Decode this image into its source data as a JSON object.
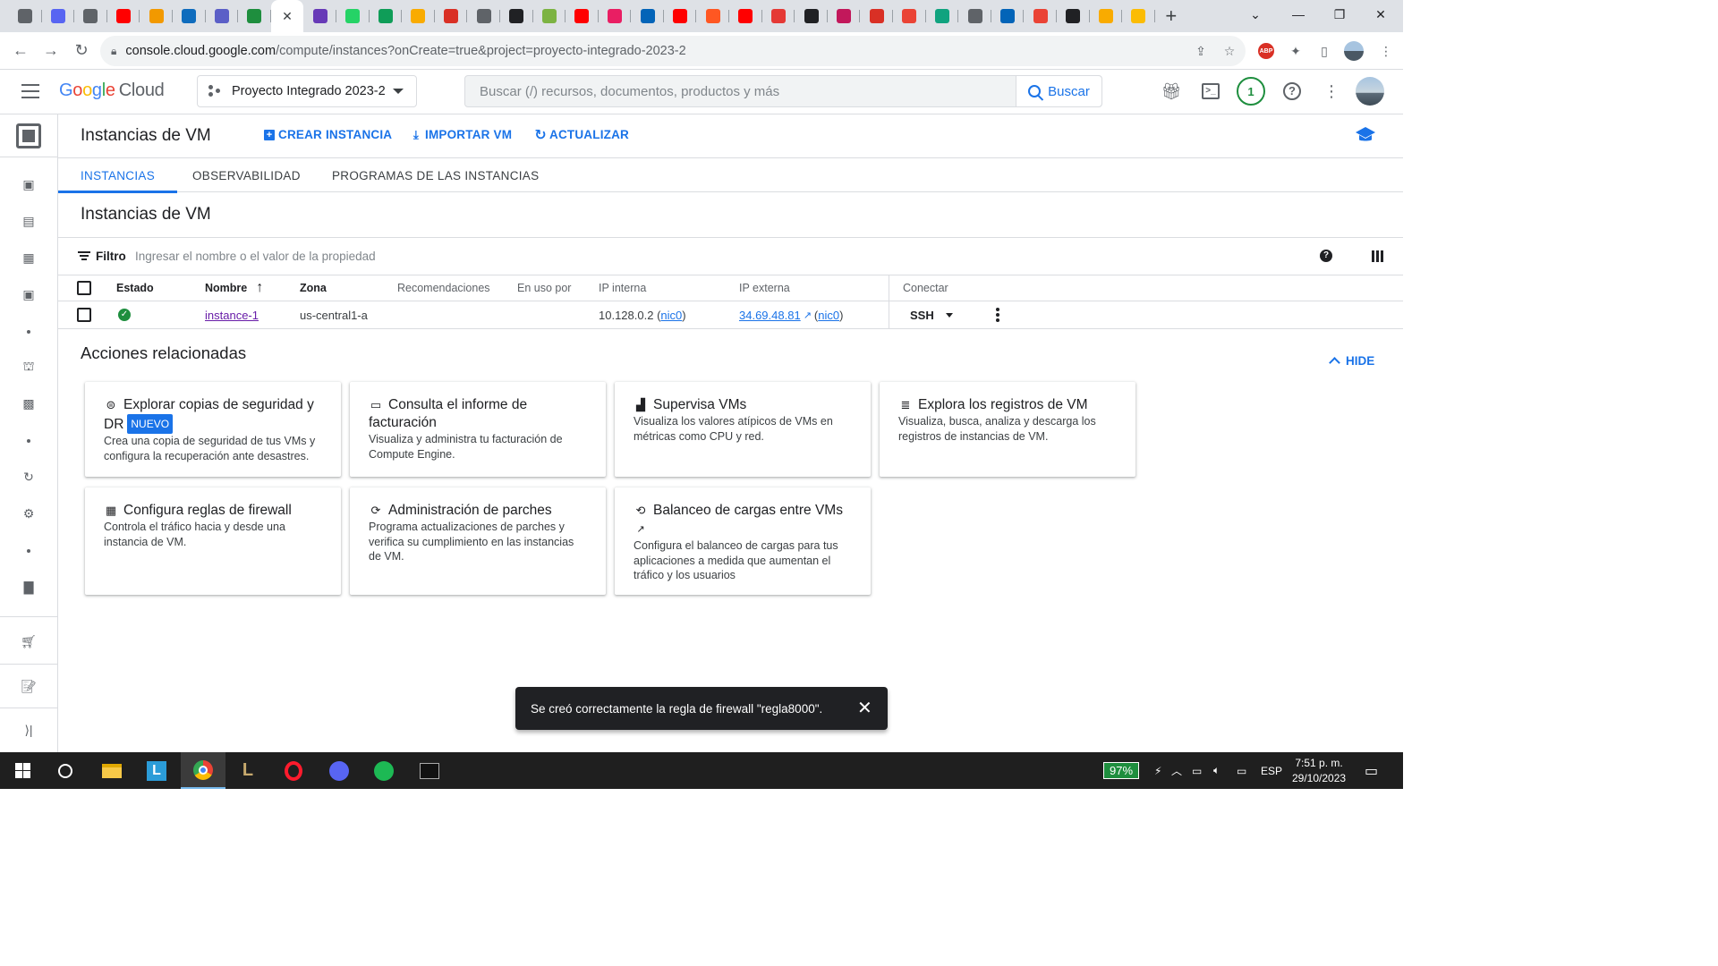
{
  "browser": {
    "tabs": [
      {
        "icon": "chrome-icon",
        "color": "#5f6368"
      },
      {
        "icon": "discord-icon",
        "color": "#5865f2"
      },
      {
        "icon": "chrome-icon",
        "color": "#5f6368"
      },
      {
        "icon": "youtube-icon",
        "color": "#ff0000"
      },
      {
        "icon": "app-icon",
        "color": "#f29900"
      },
      {
        "icon": "outlook-icon",
        "color": "#0f6cbd"
      },
      {
        "icon": "teams-icon",
        "color": "#5b5fc7"
      },
      {
        "icon": "drive-icon",
        "color": "#1e8e3e"
      },
      {
        "icon": "close-icon",
        "color": "#3c4043",
        "active": true
      },
      {
        "icon": "forms-icon",
        "color": "#673ab7"
      },
      {
        "icon": "whatsapp-icon",
        "color": "#25d366"
      },
      {
        "icon": "sheets-icon",
        "color": "#0f9d58"
      },
      {
        "icon": "app-icon",
        "color": "#f9ab00"
      },
      {
        "icon": "app-icon",
        "color": "#d93025"
      },
      {
        "icon": "cisco-icon",
        "color": "#5f6368"
      },
      {
        "icon": "h-icon",
        "color": "#202124"
      },
      {
        "icon": "app-icon",
        "color": "#7cb342"
      },
      {
        "icon": "youtube-icon",
        "color": "#ff0000"
      },
      {
        "icon": "ef-icon",
        "color": "#e91e63"
      },
      {
        "icon": "onedrive-icon",
        "color": "#0364b8"
      },
      {
        "icon": "youtube-icon",
        "color": "#ff0000"
      },
      {
        "icon": "app-icon",
        "color": "#ff5722"
      },
      {
        "icon": "youtube-icon",
        "color": "#ff0000"
      },
      {
        "icon": "app-icon",
        "color": "#e53935"
      },
      {
        "icon": "app-icon",
        "color": "#202124"
      },
      {
        "icon": "app-icon",
        "color": "#c2185b"
      },
      {
        "icon": "cloud-icon",
        "color": "#d93025"
      },
      {
        "icon": "gmail-icon",
        "color": "#ea4335"
      },
      {
        "icon": "openai-icon",
        "color": "#10a37f"
      },
      {
        "icon": "chrome-icon",
        "color": "#5f6368"
      },
      {
        "icon": "onedrive-icon",
        "color": "#0364b8"
      },
      {
        "icon": "gmail-icon",
        "color": "#ea4335"
      },
      {
        "icon": "github-icon",
        "color": "#202124"
      },
      {
        "icon": "app-icon",
        "color": "#f9ab00"
      },
      {
        "icon": "app-icon",
        "color": "#fbbc04"
      }
    ],
    "new_tab": "+",
    "url_host": "console.cloud.google.com",
    "url_path": "/compute/instances?onCreate=true&project=proyecto-integrado-2023-2",
    "abp_label": "ABP"
  },
  "header": {
    "logo_g": "G",
    "logo_o1": "o",
    "logo_o2": "o",
    "logo_g2": "g",
    "logo_l": "l",
    "logo_e": "e",
    "logo_cloud": "Cloud",
    "project": "Proyecto Integrado 2023-2",
    "search_placeholder": "Buscar (/) recursos, documentos, productos y más",
    "search_button": "Buscar",
    "notifications_count": "1"
  },
  "titlebar": {
    "title": "Instancias de VM",
    "create": "CREAR INSTANCIA",
    "import": "IMPORTAR VM",
    "refresh": "ACTUALIZAR"
  },
  "tabs": [
    "INSTANCIAS",
    "OBSERVABILIDAD",
    "PROGRAMAS DE LAS INSTANCIAS"
  ],
  "section_title": "Instancias de VM",
  "filter": {
    "label": "Filtro",
    "placeholder": "Ingresar el nombre o el valor de la propiedad"
  },
  "table": {
    "headers": {
      "status": "Estado",
      "name": "Nombre",
      "zone": "Zona",
      "recommendations": "Recomendaciones",
      "in_use_by": "En uso por",
      "internal_ip": "IP interna",
      "external_ip": "IP externa",
      "connect": "Conectar"
    },
    "row": {
      "name": "instance-1",
      "zone": "us-central1-a",
      "internal_ip": "10.128.0.2",
      "internal_nic": "nic0",
      "external_ip": "34.69.48.81",
      "external_nic": "nic0",
      "connect": "SSH"
    }
  },
  "related": {
    "title": "Acciones relacionadas",
    "hide": "HIDE",
    "cards": [
      {
        "title": "Explorar copias de seguridad y DR",
        "badge": "NUEVO",
        "desc": "Crea una copia de seguridad de tus VMs y configura la recuperación ante desastres."
      },
      {
        "title": "Consulta el informe de facturación",
        "desc": "Visualiza y administra tu facturación de Compute Engine."
      },
      {
        "title": "Supervisa VMs",
        "desc": "Visualiza los valores atípicos de VMs en métricas como CPU y red."
      },
      {
        "title": "Explora los registros de VM",
        "desc": "Visualiza, busca, analiza y descarga los registros de instancias de VM."
      },
      {
        "title": "Configura reglas de firewall",
        "desc": "Controla el tráfico hacia y desde una instancia de VM."
      },
      {
        "title": "Administración de parches",
        "desc": "Programa actualizaciones de parches y verifica su cumplimiento en las instancias de VM."
      },
      {
        "title": "Balanceo de cargas entre VMs",
        "desc": "Configura el balanceo de cargas para tus aplicaciones a medida que aumentan el tráfico y los usuarios"
      }
    ]
  },
  "snackbar": {
    "message": "Se creó correctamente la regla de firewall \"regla8000\"."
  },
  "taskbar": {
    "battery": "97%",
    "language": "ESP",
    "time": "7:51 p. m.",
    "date": "29/10/2023"
  }
}
